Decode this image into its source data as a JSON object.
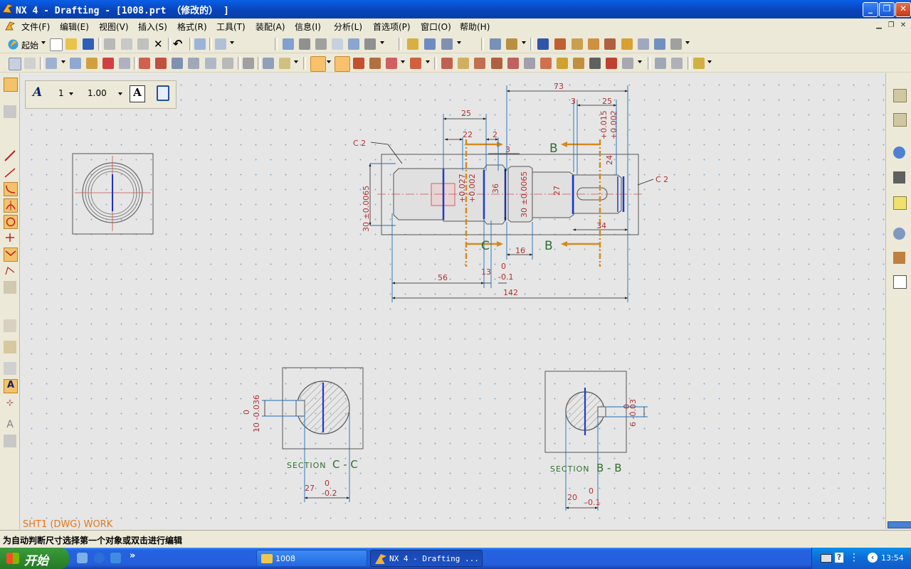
{
  "window": {
    "title": "NX 4 - Drafting - [1008.prt （修改的） ]",
    "minimize_label": "_",
    "restore_label": "❐",
    "close_label": "✕"
  },
  "menu": {
    "items": [
      {
        "label": "文件(F)"
      },
      {
        "label": "编辑(E)"
      },
      {
        "label": "视图(V)"
      },
      {
        "label": "插入(S)"
      },
      {
        "label": "格式(R)"
      },
      {
        "label": "工具(T)"
      },
      {
        "label": "装配(A)"
      },
      {
        "label": "信息(I)"
      },
      {
        "label": "分析(L)"
      },
      {
        "label": "首选项(P)"
      },
      {
        "label": "窗口(O)"
      },
      {
        "label": "帮助(H)"
      }
    ]
  },
  "toolbar": {
    "start_label": "起始"
  },
  "annotation_toolbar": {
    "line_weight": "1",
    "scale": "1.00"
  },
  "drawing": {
    "sheet_label": "SHT1 (DWG) WORK",
    "section_cc_word": "SECTION",
    "section_cc_letters": "C - C",
    "section_bb_word": "SECTION",
    "section_bb_letters": "B - B",
    "dims": {
      "d73": "73",
      "d25a": "25",
      "d25b": "25",
      "d22": "22",
      "d2": "2",
      "d3": "3",
      "d3b": "3",
      "c2a": "C 2",
      "c2b": "C 2",
      "tol_015": "+0.015",
      "tol_002": "+0.002",
      "dia30a": "30 ±0.0065",
      "dia24": "24",
      "dia30b": "30 ±0.0065",
      "dia27": "27",
      "dia36": "36",
      "dia_tol_027": "+0.027",
      "dia_tol_002b": "+0.002",
      "d16": "16",
      "d34": "34",
      "d56": "56",
      "d13": "13",
      "d0a": "0",
      "dm01a": "-0.1",
      "d142": "142",
      "arrow_b": "B",
      "arrow_c": "C",
      "cc_0": "0",
      "cc_10": "10 -0.036",
      "cc_27": "27",
      "cc_27_0": "0",
      "cc_27_tol": "-0.2",
      "bb_20": "20",
      "bb_0": "0",
      "bb_tol": "-0.1",
      "bb_6": "6 -0.03",
      "bb_6_0": "0"
    }
  },
  "status": {
    "message": "为自动判断尺寸选择第一个对象或双击进行编辑"
  },
  "taskbar": {
    "start_label": "开始",
    "task1_label": "1008",
    "task2_label": "NX 4 - Drafting ...",
    "clock": "13:54",
    "quicklaunch_more": "»"
  }
}
